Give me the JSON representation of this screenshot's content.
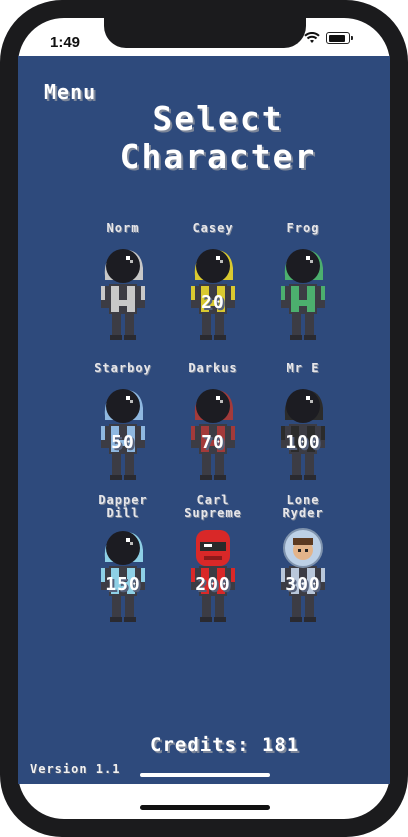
{
  "status": {
    "time": "1:49"
  },
  "game": {
    "menu_label": "Menu",
    "title_line1": "Select",
    "title_line2": "Character",
    "credits_label": "Credits: 181",
    "version_label": "Version 1.1",
    "colors": {
      "background": "#2e4a7c",
      "text": "#ffffff",
      "text_shadow": "#7c8699"
    }
  },
  "characters": [
    {
      "name": "Norm",
      "price": "",
      "suit_color": "#c8c8c8",
      "style": "helmet"
    },
    {
      "name": "Casey",
      "price": "20",
      "suit_color": "#d9c930",
      "style": "helmet"
    },
    {
      "name": "Frog",
      "price": "",
      "suit_color": "#4caf6e",
      "style": "helmet"
    },
    {
      "name": "Starboy",
      "price": "50",
      "suit_color": "#8fb8e0",
      "style": "helmet"
    },
    {
      "name": "Darkus",
      "price": "70",
      "suit_color": "#a33a3a",
      "style": "helmet"
    },
    {
      "name": "Mr E",
      "price": "100",
      "suit_color": "#2b2b2b",
      "style": "helmet"
    },
    {
      "name": "Dapper Dill",
      "price": "150",
      "suit_color": "#8ed0e6",
      "style": "helmet"
    },
    {
      "name": "Carl Supreme",
      "price": "200",
      "suit_color": "#d92828",
      "style": "racer"
    },
    {
      "name": "Lone Ryder",
      "price": "300",
      "suit_color": "#b9c7da",
      "style": "bubble"
    }
  ]
}
